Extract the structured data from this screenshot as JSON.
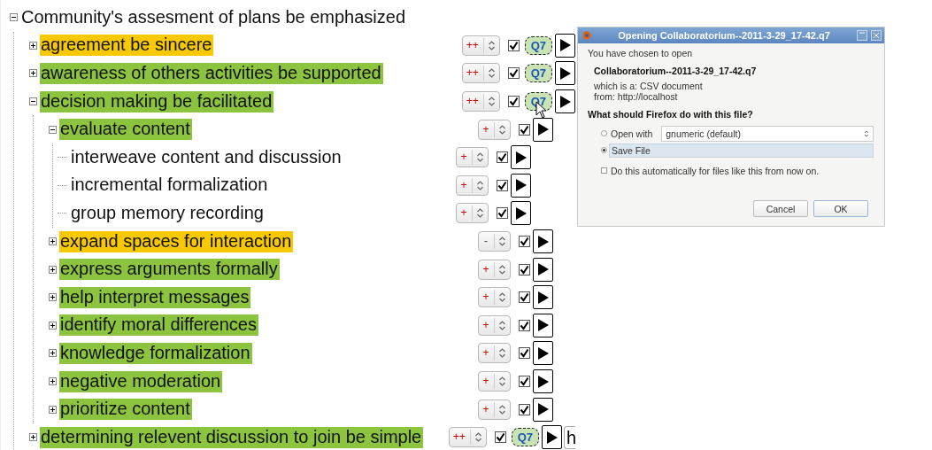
{
  "tree": {
    "label": "Community's assesment of plans be emphasized",
    "expanded": true,
    "children": [
      {
        "label": "agreement be sincere",
        "color": "#f8c900",
        "expanded": false,
        "rating": "++",
        "checked": true,
        "badge": "Q7"
      },
      {
        "label": "awareness of others activities be supported",
        "color": "#8cc43f",
        "expanded": false,
        "rating": "++",
        "checked": true,
        "badge": "Q7"
      },
      {
        "label": "decision making be facilitated",
        "color": "#8cc43f",
        "expanded": true,
        "rating": "++",
        "checked": true,
        "badge": "Q7",
        "children": [
          {
            "label": "evaluate content",
            "color": "#8cc43f",
            "expanded": true,
            "rating": "+",
            "checked": true,
            "children": [
              {
                "label": "interweave content and discussion",
                "rating": "+",
                "checked": true
              },
              {
                "label": "incremental formalization",
                "rating": "+",
                "checked": true
              },
              {
                "label": "group memory recording",
                "rating": "+",
                "checked": true
              }
            ]
          },
          {
            "label": "expand spaces for interaction",
            "color": "#f8c900",
            "expanded": false,
            "rating": "-",
            "checked": true
          },
          {
            "label": "express arguments formally",
            "color": "#8cc43f",
            "expanded": false,
            "rating": "+",
            "checked": true
          },
          {
            "label": "help interpret messages",
            "color": "#8cc43f",
            "expanded": false,
            "rating": "+",
            "checked": true
          },
          {
            "label": "identify moral differences",
            "color": "#8cc43f",
            "expanded": false,
            "rating": "+",
            "checked": true
          },
          {
            "label": "knowledge formalization",
            "color": "#8cc43f",
            "expanded": false,
            "rating": "+",
            "checked": true
          },
          {
            "label": "negative moderation",
            "color": "#8cc43f",
            "expanded": false,
            "rating": "+",
            "checked": true
          },
          {
            "label": "prioritize content",
            "color": "#8cc43f",
            "expanded": false,
            "rating": "+",
            "checked": true
          }
        ]
      },
      {
        "label": "determining relevent discussion to join be simple",
        "color": "#8cc43f",
        "expanded": false,
        "rating": "++",
        "checked": true,
        "badge": "Q7",
        "extra": "h"
      }
    ]
  },
  "dialog": {
    "title": "Opening Collaboratorium--2011-3-29_17-42.q7",
    "intro": "You have chosen to open",
    "filename": "Collaboratorium--2011-3-29_17-42.q7",
    "type_line": "which is a: CSV document",
    "from_line": "from: http://localhost",
    "question": "What should Firefox do with this file?",
    "options": [
      {
        "label": "Open with",
        "selected": false,
        "app": "gnumeric (default)"
      },
      {
        "label": "Save File",
        "selected": true
      }
    ],
    "remember": {
      "label": "Do this automatically for files like this from now on.",
      "checked": false
    },
    "buttons": [
      "Cancel",
      "OK"
    ]
  }
}
